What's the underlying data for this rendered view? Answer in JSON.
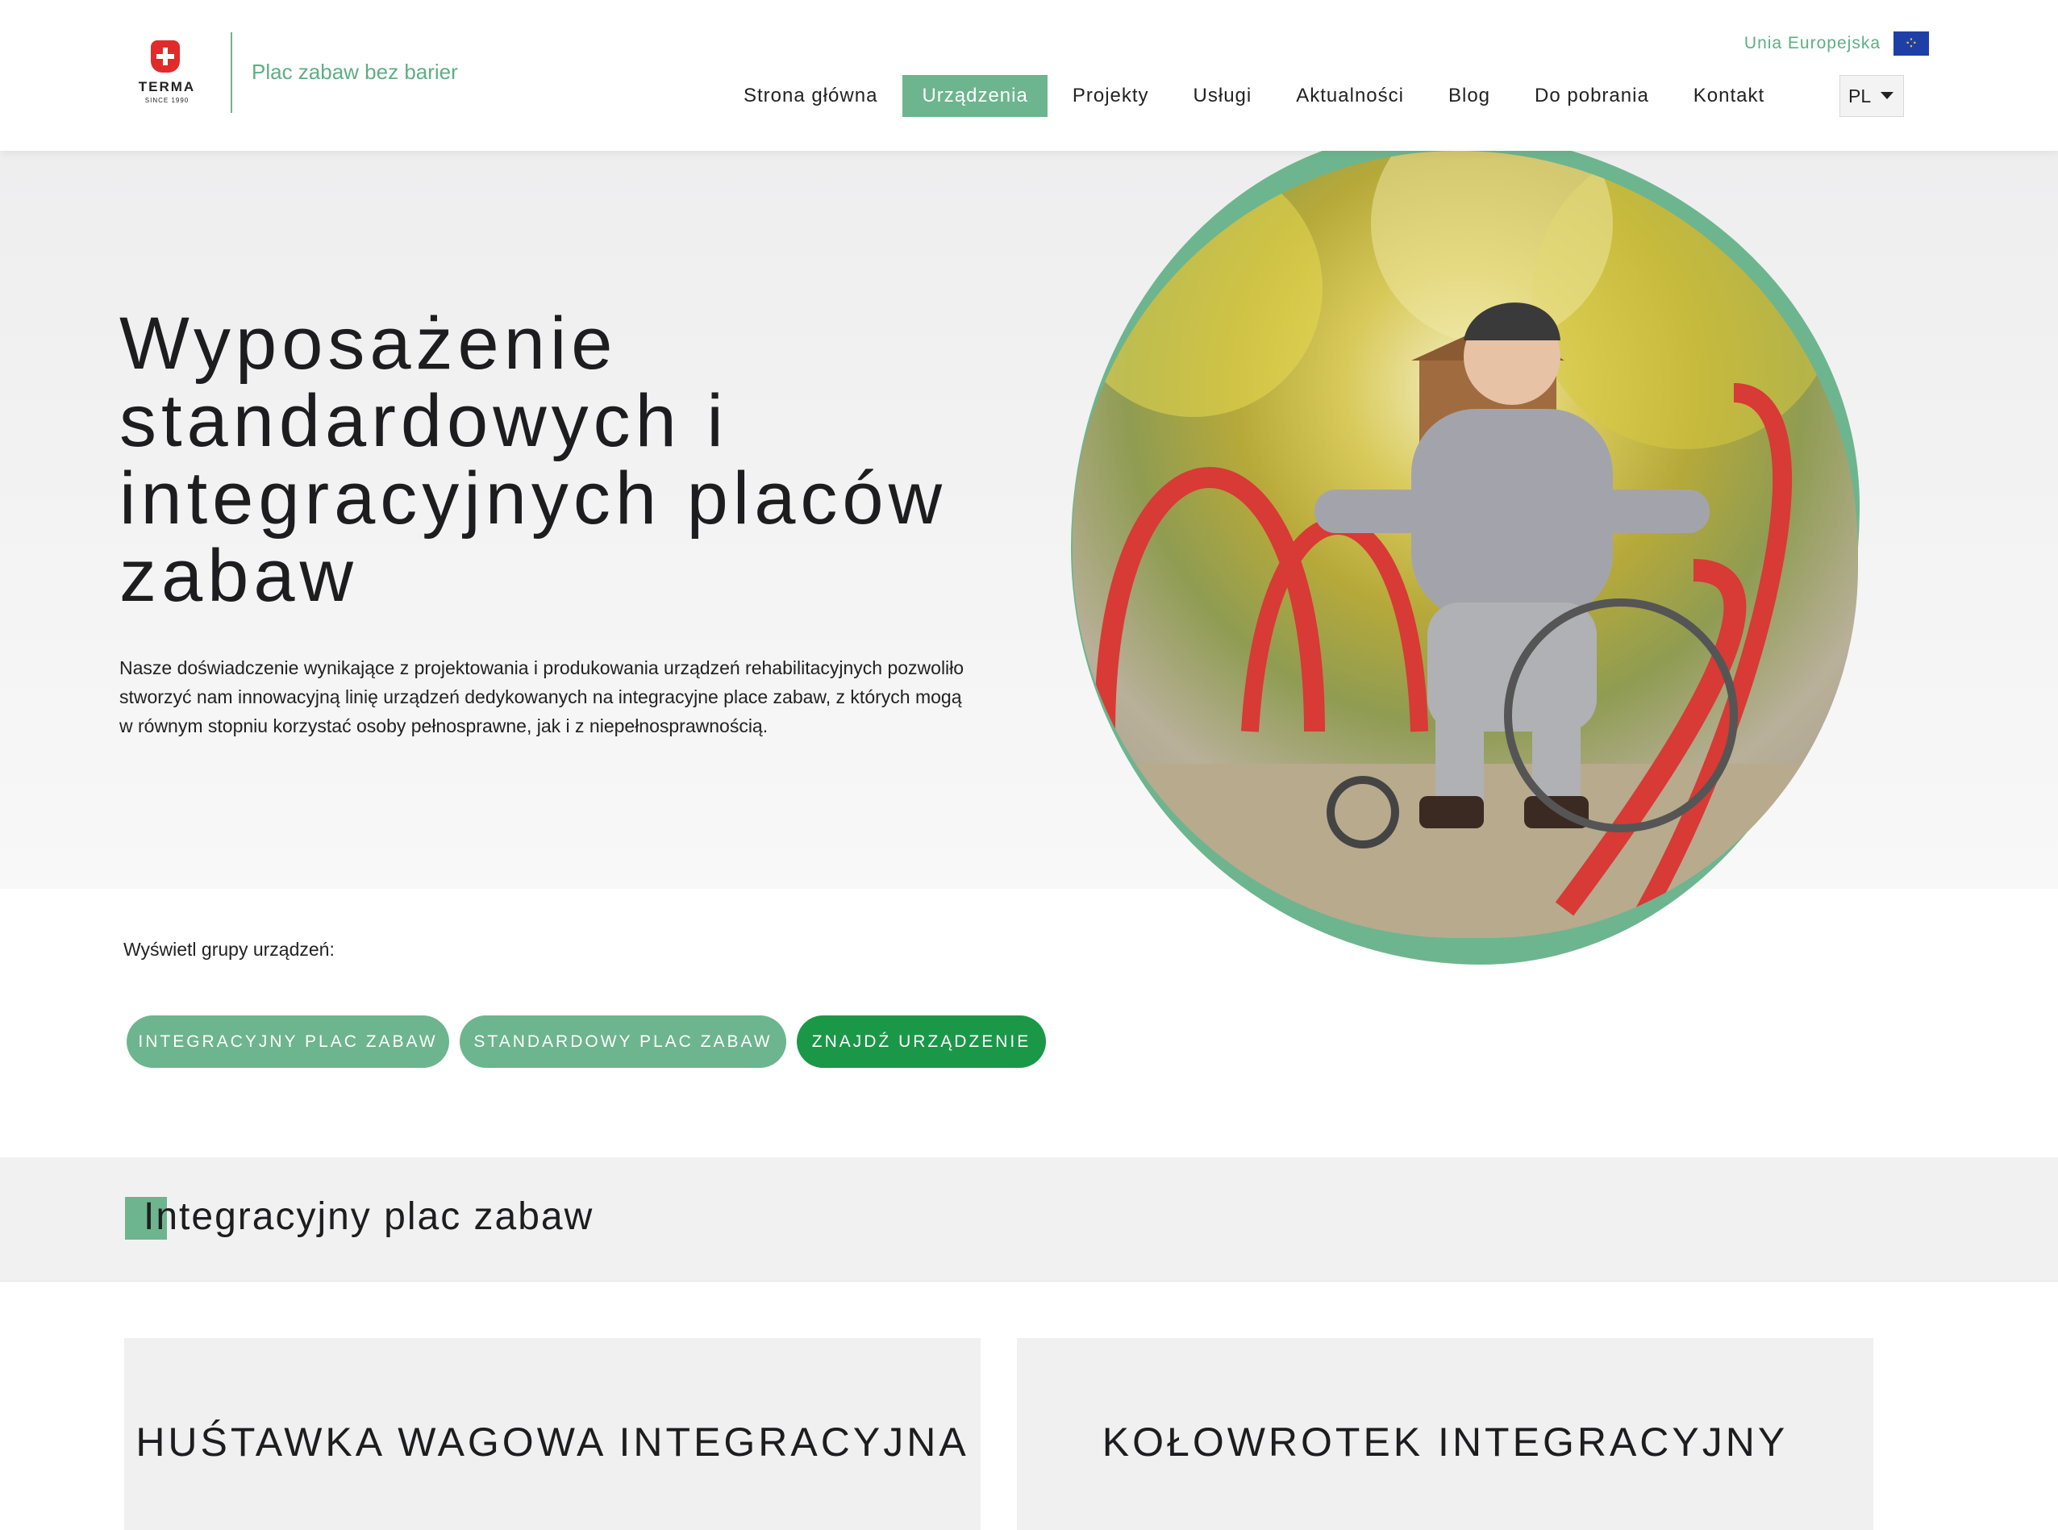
{
  "header": {
    "logo": {
      "word": "TERMA",
      "since": "SINCE 1990"
    },
    "tagline": "Plac zabaw bez barier",
    "eu_label": "Unia Europejska",
    "eu_flag_icon": "eu-flag-icon",
    "nav": [
      {
        "label": "Strona główna",
        "active": false
      },
      {
        "label": "Urządzenia",
        "active": true
      },
      {
        "label": "Projekty",
        "active": false
      },
      {
        "label": "Usługi",
        "active": false
      },
      {
        "label": "Aktualności",
        "active": false
      },
      {
        "label": "Blog",
        "active": false
      },
      {
        "label": "Do pobrania",
        "active": false
      },
      {
        "label": "Kontakt",
        "active": false
      }
    ],
    "language": "PL"
  },
  "hero": {
    "title": "Wyposażenie standardowych i integracyjnych placów zabaw",
    "text": "Nasze doświadczenie wynikające z projektowania i produkowania urządzeń rehabilitacyjnych pozwoliło stworzyć nam innowacyjną linię urządzeń dedykowanych na integracyjne place zabaw, z których mogą w równym stopniu korzystać osoby pełnosprawne, jak i z niepełnosprawnością."
  },
  "groups": {
    "label": "Wyświetl grupy urządzeń:",
    "buttons": [
      "INTEGRACYJNY PLAC ZABAW",
      "STANDARDOWY PLAC ZABAW",
      "ZNAJDŹ URZĄDZENIE"
    ]
  },
  "section": {
    "title": "Integracyjny plac zabaw"
  },
  "cards": [
    {
      "title": "HUŚTAWKA WAGOWA INTEGRACYJNA"
    },
    {
      "title": "KOŁOWROTEK INTEGRACYJNY"
    }
  ],
  "colors": {
    "accent": "#6db58e",
    "accent_dark": "#1a9848",
    "logo_red": "#e12b2b"
  }
}
